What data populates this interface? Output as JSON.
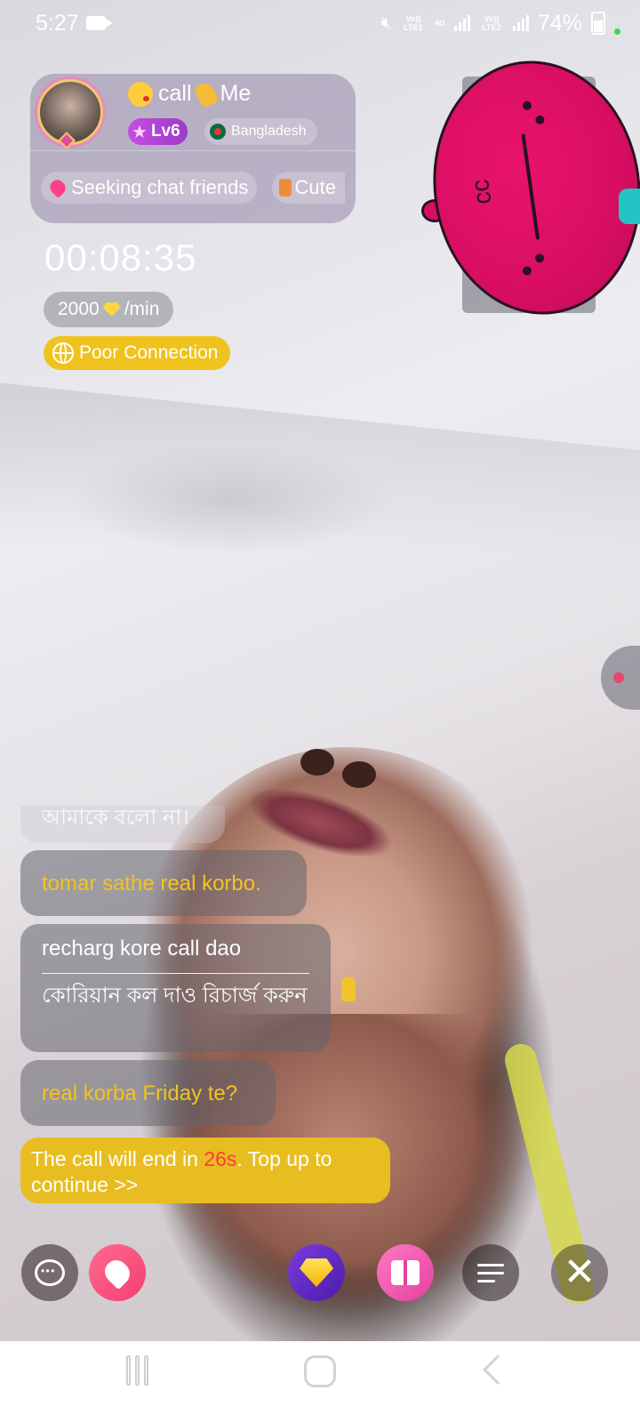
{
  "status_bar": {
    "time": "5:27",
    "sim1_label": "Vo)) LTE1",
    "net_label": "4G",
    "sim2_label": "Vo)) LTE2",
    "battery": "74%"
  },
  "host": {
    "name_prefix": "call",
    "name_suffix": "Me",
    "level": "Lv6",
    "country": "Bangladesh",
    "tags": [
      "Seeking chat friends",
      "Cute"
    ]
  },
  "call": {
    "timer": "00:08:35",
    "rate_value": "2000",
    "rate_unit": "/min",
    "connection_status": "Poor Connection"
  },
  "chat": {
    "messages": [
      {
        "text": "আমাকে বলো না।"
      },
      {
        "text": "tomar sathe real korbo."
      },
      {
        "text": "recharg kore call dao",
        "translation": "কোরিয়ান কল দাও রিচার্জ করুন"
      },
      {
        "text": "real korba Friday te?"
      }
    ]
  },
  "banner": {
    "prefix": "The call will end in ",
    "countdown": "26s",
    "suffix": ". Top up to continue >>"
  },
  "icons": {
    "chat": "chat-bubble-icon",
    "like": "heart-message-icon",
    "recharge": "diamond-icon",
    "gift": "gift-icon",
    "menu": "menu-icon",
    "close": "close-icon"
  },
  "colors": {
    "accent_yellow": "#f0c21e",
    "countdown_red": "#ff3a3a",
    "level_purple": "#c54de3"
  }
}
